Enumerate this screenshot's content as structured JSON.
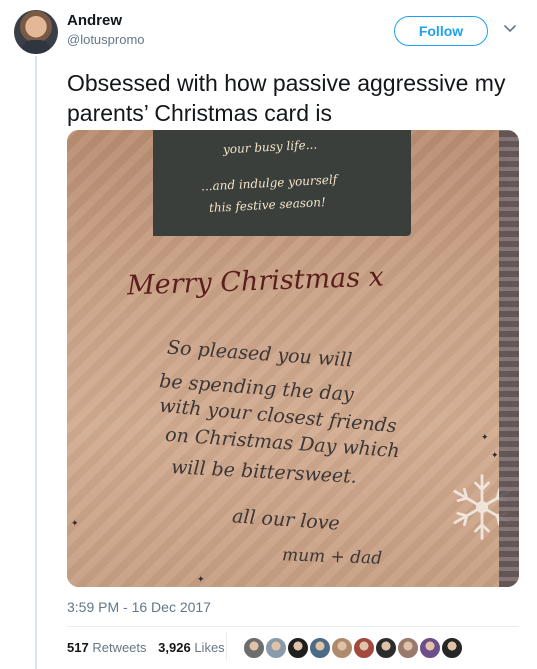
{
  "header": {
    "author_name": "Andrew",
    "author_handle": "@lotuspromo",
    "follow_label": "Follow"
  },
  "tweet": {
    "text": "Obsessed with how passive aggressive my parents’ Christmas card is",
    "timestamp": "3:59 PM - 16 Dec 2017"
  },
  "photo": {
    "chalkboard_lines": [
      "your busy life...",
      "...and indulge yourself",
      "this festive season!"
    ],
    "greeting": "Merry Christmas x",
    "message_lines": [
      "So pleased you will",
      "be spending the day",
      "with your closest friends",
      "on Christmas Day which",
      "will be bittersweet.",
      "all our love",
      "mum + dad"
    ]
  },
  "stats": {
    "retweets_count": "517",
    "retweets_label": "Retweets",
    "likes_count": "3,926",
    "likes_label": "Likes"
  },
  "likers": [
    {
      "color": "#6d6d6d"
    },
    {
      "color": "#8a9aa8"
    },
    {
      "color": "#1f1f1f"
    },
    {
      "color": "#4d6a86"
    },
    {
      "color": "#b08a6c"
    },
    {
      "color": "#a2483c"
    },
    {
      "color": "#2c2c2c"
    },
    {
      "color": "#9a7a6c"
    },
    {
      "color": "#6c4f8a"
    },
    {
      "color": "#262626"
    }
  ],
  "colors": {
    "accent": "#1da1f2",
    "secondary_text": "#657786",
    "primary_text": "#14171a"
  }
}
